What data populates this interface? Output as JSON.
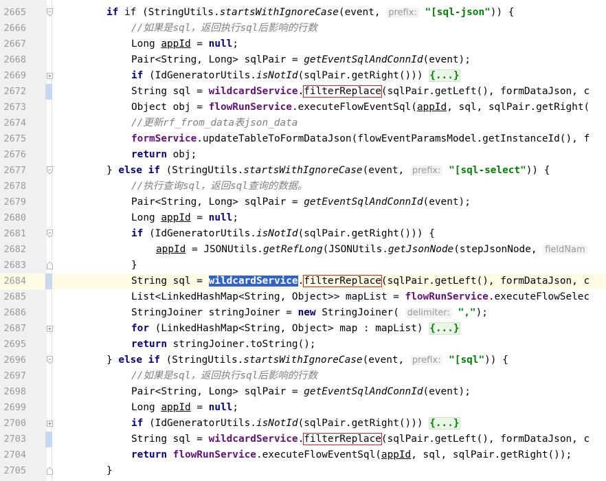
{
  "editor": {
    "lines": [
      {
        "num": "2665"
      },
      {
        "num": "2666"
      },
      {
        "num": "2667"
      },
      {
        "num": "2668"
      },
      {
        "num": "2669"
      },
      {
        "num": "2672"
      },
      {
        "num": "2673"
      },
      {
        "num": "2674"
      },
      {
        "num": "2675"
      },
      {
        "num": "2676"
      },
      {
        "num": "2677"
      },
      {
        "num": "2678"
      },
      {
        "num": "2679"
      },
      {
        "num": "2680"
      },
      {
        "num": "2681"
      },
      {
        "num": "2682"
      },
      {
        "num": "2683"
      },
      {
        "num": "2684"
      },
      {
        "num": "2685"
      },
      {
        "num": "2686"
      },
      {
        "num": "2687"
      },
      {
        "num": "2695"
      },
      {
        "num": "2696"
      },
      {
        "num": "2697"
      },
      {
        "num": "2698"
      },
      {
        "num": "2699"
      },
      {
        "num": "2700"
      },
      {
        "num": "2703"
      },
      {
        "num": "2704"
      },
      {
        "num": "2705"
      }
    ],
    "code": {
      "l2665": {
        "p1": "if (StringUtils.",
        "m": "startsWithIgnoreCase",
        "p2": "(event, ",
        "hint": "prefix:",
        "str": "\"[sql-json\"",
        "p3": ")) {"
      },
      "l2666": {
        "comment": "//如果是sql，返回执行sql后影响的行数"
      },
      "l2667": {
        "p1": "Long ",
        "v": "appId",
        "p2": " = ",
        "k": "null",
        "p3": ";"
      },
      "l2668": {
        "p1": "Pair<String, Long> sqlPair = ",
        "m": "getEventSqlAndConnId",
        "p2": "(event);"
      },
      "l2669": {
        "k": "if",
        "p1": " (IdGeneratorUtils.",
        "m": "isNotId",
        "p2": "(sqlPair.getRight())) ",
        "fold": "{...}"
      },
      "l2672": {
        "p1": "String sql = ",
        "f": "wildcardService",
        "dot": ".",
        "boxed": "filterReplace",
        "p2": "(sqlPair.getLeft(), formDataJson, c"
      },
      "l2673": {
        "p1": "Object obj = ",
        "f": "flowRunService",
        "p2": ".executeFlowEventSql(",
        "v": "appId",
        "p3": ", sql, sqlPair.getRight("
      },
      "l2674": {
        "comment": "//更新rf_from_data表json_data"
      },
      "l2675": {
        "f": "formService",
        "p1": ".updateTableToFormDataJson(flowEventParamsModel.getInstanceId(), f"
      },
      "l2676": {
        "k": "return",
        "p1": " obj;"
      },
      "l2677": {
        "p0": "} ",
        "k1": "else",
        "sp": " ",
        "k2": "if",
        "p1": " (StringUtils.",
        "m": "startsWithIgnoreCase",
        "p2": "(event, ",
        "hint": "prefix:",
        "str": "\"[sql-select\"",
        "p3": ")) {"
      },
      "l2678": {
        "comment": "//执行查询sql，返回sql查询的数据。"
      },
      "l2679": {
        "p1": "Pair<String, Long> sqlPair = ",
        "m": "getEventSqlAndConnId",
        "p2": "(event);"
      },
      "l2680": {
        "p1": "Long ",
        "v": "appId",
        "p2": " = ",
        "k": "null",
        "p3": ";"
      },
      "l2681": {
        "k": "if",
        "p1": " (IdGeneratorUtils.",
        "m": "isNotId",
        "p2": "(sqlPair.getRight())) {"
      },
      "l2682": {
        "v": "appId",
        "p1": " = JSONUtils.",
        "m1": "getRefLong",
        "p2": "(JSONUtils.",
        "m2": "getJsonNode",
        "p3": "(stepJsonNode, ",
        "hint": "fieldNam"
      },
      "l2683": {
        "p1": "}"
      },
      "l2684": {
        "p1": "String sql = ",
        "sel": "wildcardService",
        "dot": ".",
        "boxed": "filterReplace",
        "p2": "(sqlPair.getLeft(), formDataJson, c"
      },
      "l2685": {
        "p1": "List<LinkedHashMap<String, Object>> mapList = ",
        "f": "flowRunService",
        "p2": ".executeFlowSelec"
      },
      "l2686": {
        "p1": "StringJoiner stringJoiner = ",
        "k": "new",
        "p2": " StringJoiner( ",
        "hint": "delimiter:",
        "str": "\",\"",
        "p3": ");"
      },
      "l2687": {
        "k": "for",
        "p1": " (LinkedHashMap<String, Object> map : mapList) ",
        "fold": "{...}"
      },
      "l2695": {
        "k": "return",
        "p1": " stringJoiner.toString();"
      },
      "l2696": {
        "p0": "} ",
        "k1": "else",
        "sp": " ",
        "k2": "if",
        "p1": " (StringUtils.",
        "m": "startsWithIgnoreCase",
        "p2": "(event, ",
        "hint": "prefix:",
        "str": "\"[sql\"",
        "p3": ")) {"
      },
      "l2697": {
        "comment": "//如果是sql，返回执行sql后影响的行数"
      },
      "l2698": {
        "p1": "Pair<String, Long> sqlPair = ",
        "m": "getEventSqlAndConnId",
        "p2": "(event);"
      },
      "l2699": {
        "p1": "Long ",
        "v": "appId",
        "p2": " = ",
        "k": "null",
        "p3": ";"
      },
      "l2700": {
        "k": "if",
        "p1": " (IdGeneratorUtils.",
        "m": "isNotId",
        "p2": "(sqlPair.getRight())) ",
        "fold": "{...}"
      },
      "l2703": {
        "p1": "String sql = ",
        "f": "wildcardService",
        "dot": ".",
        "boxed": "filterReplace",
        "p2": "(sqlPair.getLeft(), formDataJson, c"
      },
      "l2704": {
        "k": "return",
        "p1": " ",
        "f": "flowRunService",
        "p2": ".executeFlowEventSql(",
        "v": "appId",
        "p3": ", sql, sqlPair.getRight());"
      },
      "l2705": {
        "p1": "}"
      }
    }
  },
  "colors": {
    "keyword": "#000080",
    "field": "#660e7a",
    "string": "#008000",
    "comment": "#808080",
    "selection": "#2f65ca",
    "current_line": "#fffae3",
    "annotation_box": "#e02020"
  }
}
